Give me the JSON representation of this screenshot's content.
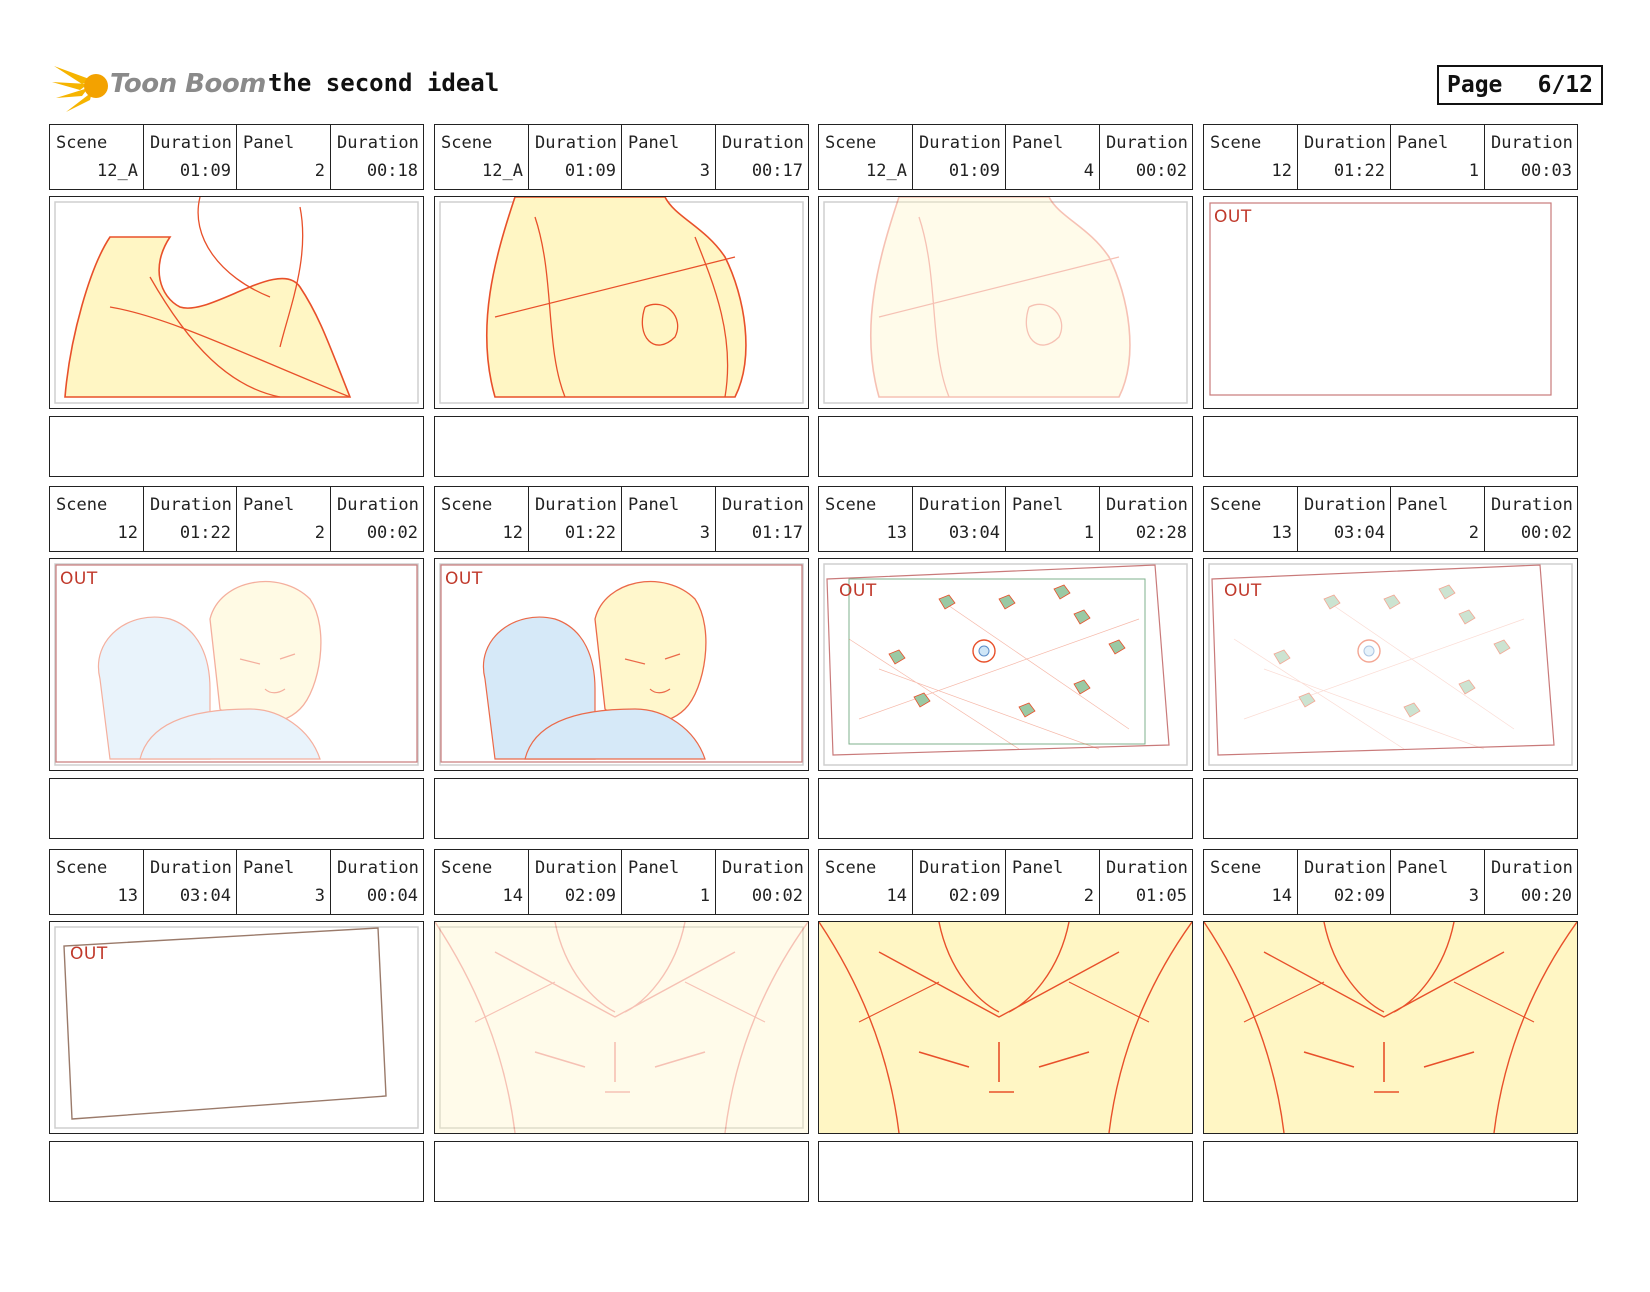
{
  "header": {
    "logo_text": "Toon Boom",
    "title": "the second ideal",
    "page_label": "Page",
    "page_number": "6/12"
  },
  "labels": {
    "scene": "Scene",
    "duration": "Duration",
    "panel": "Panel"
  },
  "panels": [
    {
      "scene": "12_A",
      "scene_duration": "01:09",
      "panel": "2",
      "panel_duration": "00:18",
      "out_tag": ""
    },
    {
      "scene": "12_A",
      "scene_duration": "01:09",
      "panel": "3",
      "panel_duration": "00:17",
      "out_tag": ""
    },
    {
      "scene": "12_A",
      "scene_duration": "01:09",
      "panel": "4",
      "panel_duration": "00:02",
      "out_tag": ""
    },
    {
      "scene": "12",
      "scene_duration": "01:22",
      "panel": "1",
      "panel_duration": "00:03",
      "out_tag": "OUT"
    },
    {
      "scene": "12",
      "scene_duration": "01:22",
      "panel": "2",
      "panel_duration": "00:02",
      "out_tag": "OUT"
    },
    {
      "scene": "12",
      "scene_duration": "01:22",
      "panel": "3",
      "panel_duration": "01:17",
      "out_tag": "OUT"
    },
    {
      "scene": "13",
      "scene_duration": "03:04",
      "panel": "1",
      "panel_duration": "02:28",
      "out_tag": "OUT"
    },
    {
      "scene": "13",
      "scene_duration": "03:04",
      "panel": "2",
      "panel_duration": "00:02",
      "out_tag": "OUT"
    },
    {
      "scene": "13",
      "scene_duration": "03:04",
      "panel": "3",
      "panel_duration": "00:04",
      "out_tag": "OUT"
    },
    {
      "scene": "14",
      "scene_duration": "02:09",
      "panel": "1",
      "panel_duration": "00:02",
      "out_tag": ""
    },
    {
      "scene": "14",
      "scene_duration": "02:09",
      "panel": "2",
      "panel_duration": "01:05",
      "out_tag": ""
    },
    {
      "scene": "14",
      "scene_duration": "02:09",
      "panel": "3",
      "panel_duration": "00:20",
      "out_tag": ""
    }
  ],
  "colors": {
    "sketch_line": "#e8502a",
    "skin_fill": "#fff6c4",
    "hair_fill": "#cfe6f7",
    "frame_line": "#c97a7a",
    "out_text": "#c0392b"
  }
}
